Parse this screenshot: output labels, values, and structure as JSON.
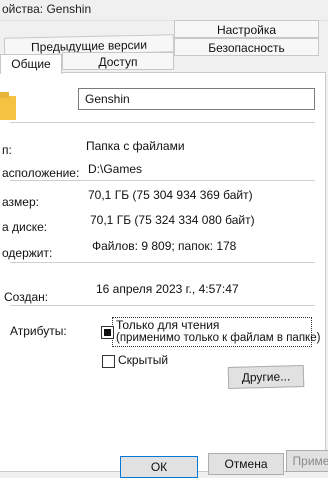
{
  "window": {
    "title": "ойства: Genshin"
  },
  "tabs": {
    "settings": "Настройка",
    "previous_versions": "Предыдущие версии",
    "security": "Безопасность",
    "general": "Общие",
    "access": "Доступ"
  },
  "general": {
    "name_value": "Genshin",
    "type_label": "п:",
    "type_value": "Папка с файлами",
    "location_label": "асположение:",
    "location_value": "D:\\Games",
    "size_label": "азмер:",
    "size_value": "70,1 ГБ (75 304 934 369 байт)",
    "size_on_disk_label": "а диске:",
    "size_on_disk_value": "70,1 ГБ (75 324 334 080 байт)",
    "contains_label": "одержит:",
    "contains_value": "Файлов: 9 809; папок: 178",
    "created_label": "Создан:",
    "created_value": "16 апреля 2023 г., 4:57:47",
    "attributes_label": "Атрибуты:",
    "readonly_label": "Только для чтения",
    "readonly_hint": "(применимо только к файлам в папке)",
    "hidden_label": "Скрытый",
    "other_button": "Другие..."
  },
  "buttons": {
    "ok": "ОК",
    "cancel": "Отмена",
    "apply": "Приме"
  },
  "colors": {
    "accent": "#0078d7",
    "folder": "#f5c242"
  }
}
